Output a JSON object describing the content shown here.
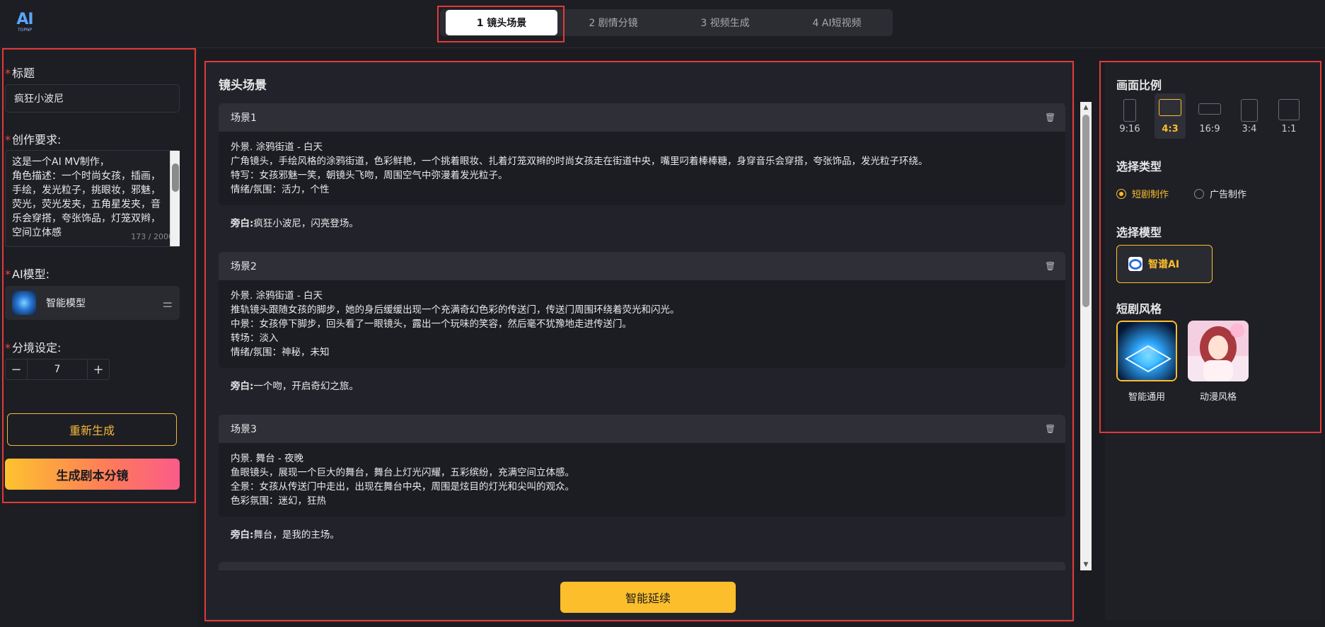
{
  "logo": {
    "main": "AI",
    "sub": "TOPNP"
  },
  "steps": [
    {
      "label": "1 镜头场景",
      "active": true
    },
    {
      "label": "2 剧情分镜",
      "active": false
    },
    {
      "label": "3 视频生成",
      "active": false
    },
    {
      "label": "4 AI短视频",
      "active": false
    }
  ],
  "left": {
    "title_label": "标题",
    "title_value": "疯狂小波尼",
    "req_label": "创作要求:",
    "req_text": "这是一个AI MV制作，\n角色描述：一个时尚女孩，插画，手绘，发光粒子，挑眼妆，邪魅，荧光，荧光发夹，五角星发夹，音乐会穿搭，夸张饰品，灯笼双辫，空间立体感\n",
    "req_count": "173 / 2000",
    "model_label": "AI模型:",
    "model_name": "智能模型",
    "scene_label": "分境设定:",
    "scene_count": "7",
    "regen_label": "重新生成",
    "generate_label": "生成剧本分镜"
  },
  "center": {
    "title": "镜头场景",
    "scenes": [
      {
        "name": "场景1",
        "lines": [
          "外景. 涂鸦街道 - 白天",
          "广角镜头，手绘风格的涂鸦街道，色彩鲜艳，一个挑着眼妆、扎着灯笼双辫的时尚女孩走在街道中央，嘴里叼着棒棒糖，身穿音乐会穿搭，夸张饰品，发光粒子环绕。",
          "特写：女孩邪魅一笑，朝镜头飞吻，周围空气中弥漫着发光粒子。",
          "情绪/氛围：活力，个性"
        ],
        "narr_label": "旁白:",
        "narr": "疯狂小波尼，闪亮登场。"
      },
      {
        "name": "场景2",
        "lines": [
          "外景. 涂鸦街道 - 白天",
          "推轨镜头跟随女孩的脚步，她的身后缓缓出现一个充满奇幻色彩的传送门，传送门周围环绕着荧光和闪光。",
          "中景：女孩停下脚步，回头看了一眼镜头，露出一个玩味的笑容，然后毫不犹豫地走进传送门。",
          "转场：淡入",
          "情绪/氛围：神秘，未知"
        ],
        "narr_label": "旁白:",
        "narr": "一个吻，开启奇幻之旅。"
      },
      {
        "name": "场景3",
        "lines": [
          "内景. 舞台 - 夜晚",
          "鱼眼镜头，展现一个巨大的舞台，舞台上灯光闪耀，五彩缤纷，充满空间立体感。",
          "全景：女孩从传送门中走出，出现在舞台中央，周围是炫目的灯光和尖叫的观众。",
          "色彩氛围：迷幻，狂热"
        ],
        "narr_label": "旁白:",
        "narr": "舞台，是我的主场。"
      }
    ],
    "extend_label": "智能延续"
  },
  "right": {
    "ratio_title": "画面比例",
    "ratios": [
      {
        "label": "9:16",
        "selected": false
      },
      {
        "label": "4:3",
        "selected": true
      },
      {
        "label": "16:9",
        "selected": false
      },
      {
        "label": "3:4",
        "selected": false
      },
      {
        "label": "1:1",
        "selected": false
      }
    ],
    "type_title": "选择类型",
    "types": [
      {
        "label": "短剧制作",
        "selected": true
      },
      {
        "label": "广告制作",
        "selected": false
      }
    ],
    "model_title": "选择模型",
    "model_name": "智谱AI",
    "style_title": "短剧风格",
    "styles": [
      {
        "label": "智能通用",
        "selected": true
      },
      {
        "label": "动漫风格",
        "selected": false
      }
    ]
  },
  "colors": {
    "accent": "#fdbe2c",
    "highlight": "#e23a3a",
    "background": "#1b1c21"
  }
}
